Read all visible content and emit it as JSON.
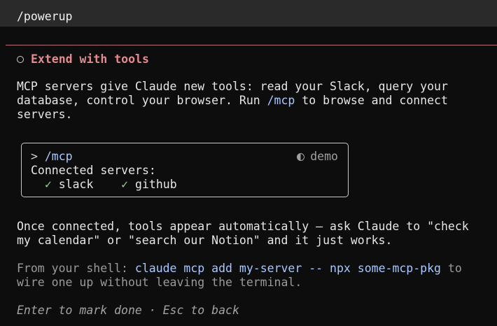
{
  "command": {
    "text": "/powerup"
  },
  "colors": {
    "background": "#0d0d0d",
    "command_bar": "#2a2a2a",
    "rule": "#b46f78",
    "title": "#e58a8f",
    "code": "#a8c8ff",
    "check": "#8fd88f"
  },
  "section": {
    "status_icon": "circle-icon",
    "title": "Extend with tools"
  },
  "intro": {
    "line1": "MCP servers give Claude new tools: read your Slack, query your",
    "line2_before": "database, control your browser. Run ",
    "line2_code": "/mcp",
    "line2_after": " to browse and connect",
    "line3": "servers."
  },
  "demo": {
    "prompt_symbol": ">",
    "command": "/mcp",
    "tag_icon": "half-circle-icon",
    "tag_label": "demo",
    "heading": "Connected servers:",
    "servers": [
      {
        "check": "✓",
        "name": "slack"
      },
      {
        "check": "✓",
        "name": "github"
      }
    ]
  },
  "followup": {
    "line1": "Once connected, tools appear automatically — ask Claude to \"check",
    "line2": "my calendar\" or \"search our Notion\" and it just works."
  },
  "shell_tip": {
    "line1_before": "From your shell: ",
    "line1_code": "claude mcp add my-server -- npx some-mcp-pkg",
    "line1_after": " to",
    "line2": "wire one up without leaving the terminal."
  },
  "footer": {
    "hint": "Enter to mark done · Esc to back"
  }
}
